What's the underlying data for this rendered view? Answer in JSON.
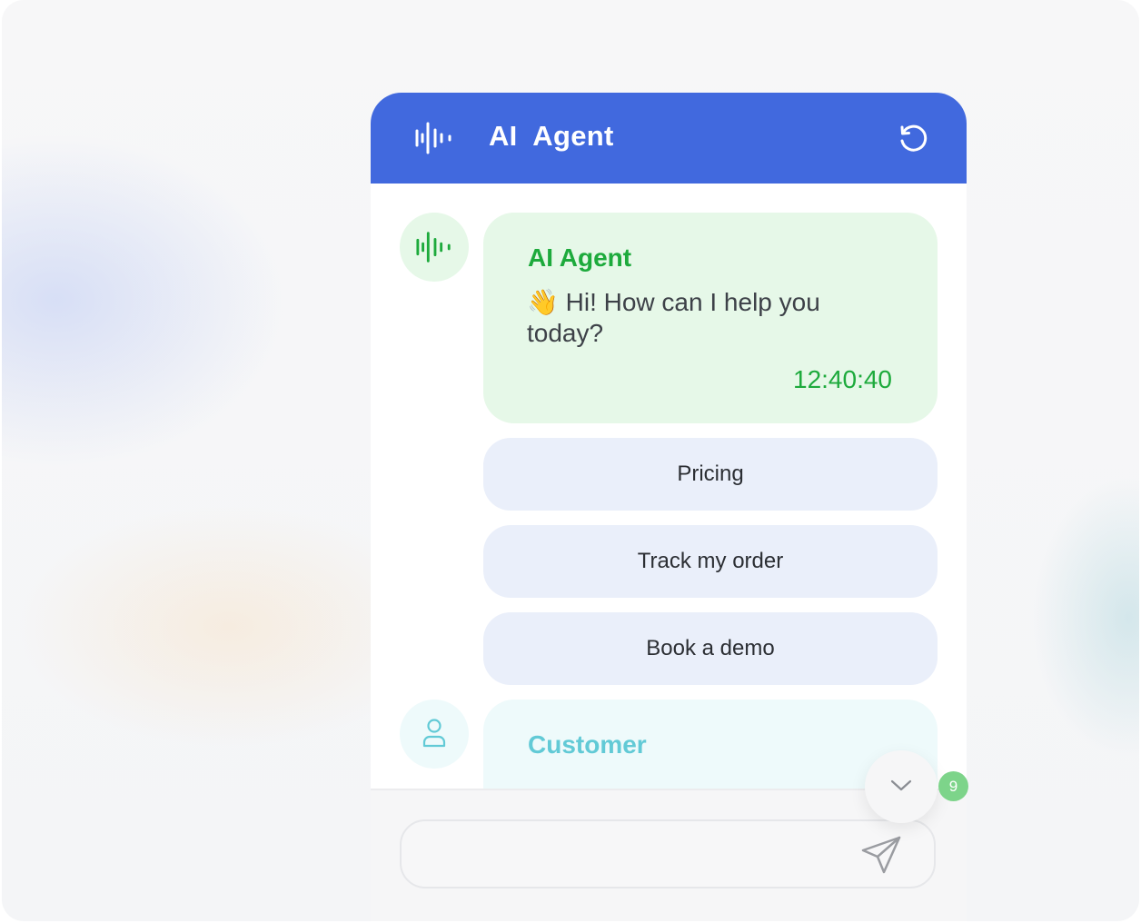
{
  "header": {
    "title": "AI  Agent",
    "logo_icon": "waveform-icon",
    "refresh_icon": "refresh-icon",
    "background_color": "#4169de"
  },
  "messages": {
    "agent": {
      "sender": "AI Agent",
      "text": "👋 Hi! How can I help you today?",
      "time": "12:40:40",
      "avatar_icon": "waveform-icon",
      "accent_color": "#1daa3c"
    },
    "customer": {
      "sender": "Customer",
      "avatar_icon": "user-icon",
      "accent_color": "#62cad6"
    }
  },
  "quick_replies": [
    {
      "label": "Pricing"
    },
    {
      "label": "Track my order"
    },
    {
      "label": "Book a demo"
    }
  ],
  "composer": {
    "value": "",
    "placeholder": "",
    "send_icon": "send-icon"
  },
  "scroll_button": {
    "icon": "chevron-down-icon",
    "unread_count": "9"
  }
}
